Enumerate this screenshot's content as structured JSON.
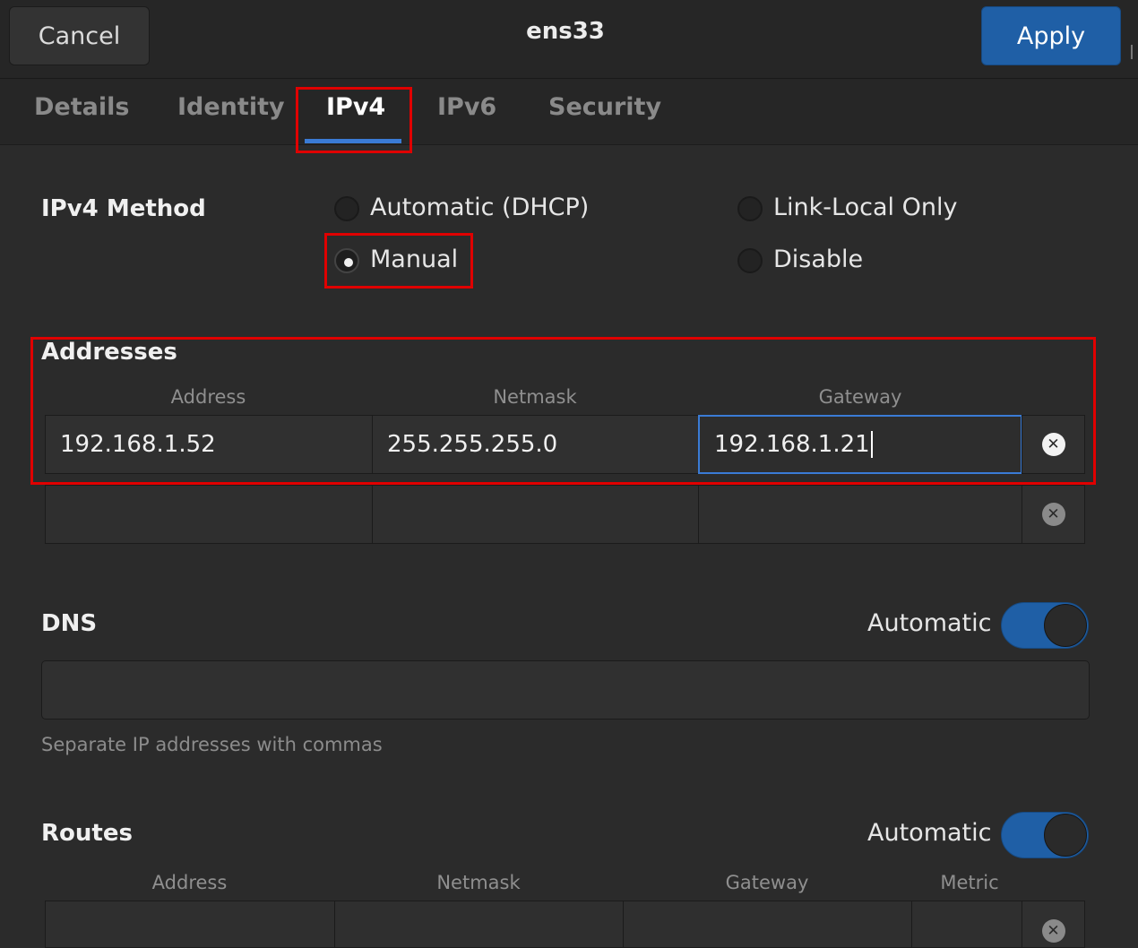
{
  "header": {
    "cancel_label": "Cancel",
    "title": "ens33",
    "apply_label": "Apply"
  },
  "tabs": [
    {
      "label": "Details",
      "active": false
    },
    {
      "label": "Identity",
      "active": false
    },
    {
      "label": "IPv4",
      "active": true
    },
    {
      "label": "IPv6",
      "active": false
    },
    {
      "label": "Security",
      "active": false
    }
  ],
  "ipv4_method": {
    "label": "IPv4 Method",
    "options": [
      {
        "label": "Automatic (DHCP)",
        "selected": false
      },
      {
        "label": "Link-Local Only",
        "selected": false
      },
      {
        "label": "Manual",
        "selected": true
      },
      {
        "label": "Disable",
        "selected": false
      }
    ]
  },
  "addresses": {
    "title": "Addresses",
    "columns": [
      "Address",
      "Netmask",
      "Gateway"
    ],
    "rows": [
      {
        "address": "192.168.1.52",
        "netmask": "255.255.255.0",
        "gateway": "192.168.1.21"
      },
      {
        "address": "",
        "netmask": "",
        "gateway": ""
      }
    ]
  },
  "dns": {
    "title": "DNS",
    "automatic_label": "Automatic",
    "automatic_on": true,
    "value": "",
    "hint": "Separate IP addresses with commas"
  },
  "routes": {
    "title": "Routes",
    "automatic_label": "Automatic",
    "automatic_on": true,
    "columns": [
      "Address",
      "Netmask",
      "Gateway",
      "Metric"
    ]
  },
  "colors": {
    "accent": "#3a7bd5",
    "apply_button": "#1f5fa6",
    "highlight_box": "#e00000",
    "background": "#2b2b2b"
  }
}
